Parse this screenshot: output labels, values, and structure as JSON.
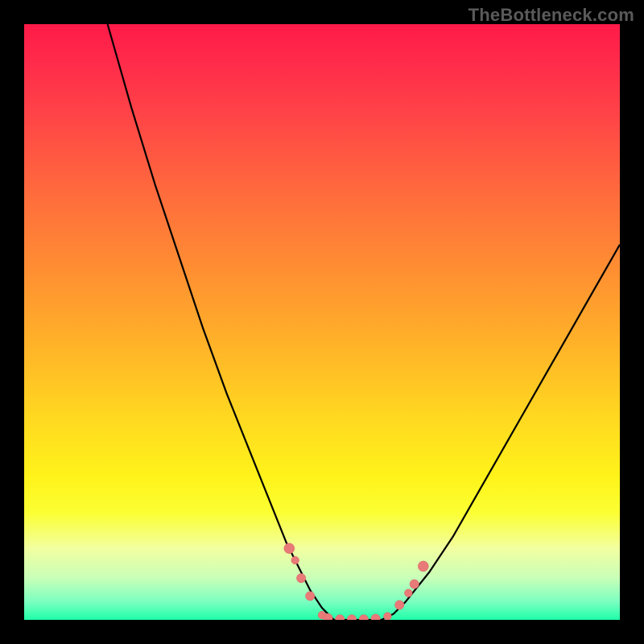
{
  "watermark": "TheBottleneck.com",
  "colors": {
    "frame_bg": "#000000",
    "curve_stroke": "#000000",
    "marker_fill": "#e87a78",
    "marker_stroke": "#d96a68"
  },
  "chart_data": {
    "type": "line",
    "title": "",
    "xlabel": "",
    "ylabel": "",
    "xlim": [
      0,
      100
    ],
    "ylim": [
      0,
      100
    ],
    "grid": false,
    "series": [
      {
        "name": "bottleneck-curve",
        "x": [
          14,
          18,
          22,
          26,
          30,
          34,
          38,
          42,
          44,
          46,
          48,
          50,
          52,
          54,
          56,
          58,
          60,
          62,
          64,
          68,
          72,
          76,
          80,
          84,
          88,
          92,
          96,
          100
        ],
        "values": [
          100,
          86,
          73,
          61,
          49,
          38,
          28,
          18,
          13,
          9,
          5,
          2,
          0,
          0,
          0,
          0,
          0,
          1,
          3,
          8,
          14,
          21,
          28,
          35,
          42,
          49,
          56,
          63
        ]
      }
    ],
    "markers": [
      {
        "x": 44.5,
        "y": 12,
        "r": 1.6
      },
      {
        "x": 45.5,
        "y": 10,
        "r": 1.2
      },
      {
        "x": 46.5,
        "y": 7,
        "r": 1.4
      },
      {
        "x": 48.0,
        "y": 4,
        "r": 1.4
      },
      {
        "x": 50.0,
        "y": 0.8,
        "r": 1.2
      },
      {
        "x": 51.0,
        "y": 0.3,
        "r": 1.4
      },
      {
        "x": 53.0,
        "y": 0.1,
        "r": 1.4
      },
      {
        "x": 55.0,
        "y": 0.1,
        "r": 1.4
      },
      {
        "x": 57.0,
        "y": 0.1,
        "r": 1.4
      },
      {
        "x": 59.0,
        "y": 0.2,
        "r": 1.4
      },
      {
        "x": 61.0,
        "y": 0.6,
        "r": 1.2
      },
      {
        "x": 63.0,
        "y": 2.5,
        "r": 1.4
      },
      {
        "x": 64.5,
        "y": 4.5,
        "r": 1.2
      },
      {
        "x": 65.5,
        "y": 6.0,
        "r": 1.4
      },
      {
        "x": 67.0,
        "y": 9.0,
        "r": 1.6
      }
    ]
  }
}
